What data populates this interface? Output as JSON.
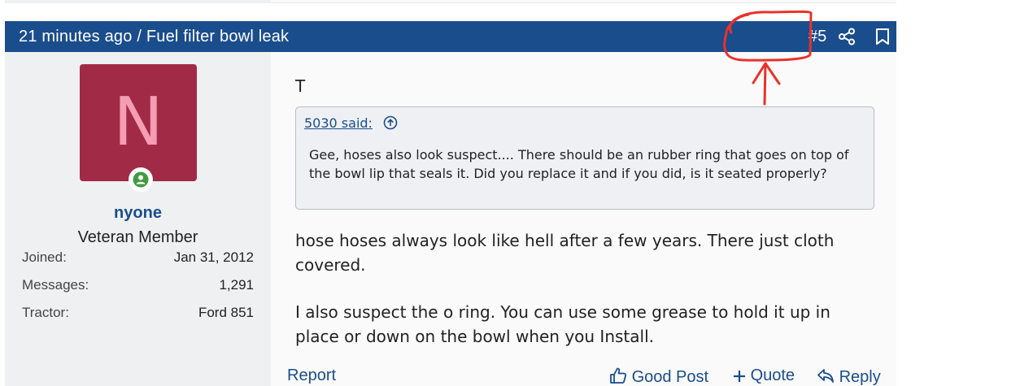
{
  "header": {
    "time_ago": "21 minutes ago",
    "separator": " / ",
    "thread_title": "Fuel filter bowl leak",
    "post_number": "#5",
    "share_icon": "share-icon",
    "bookmark_icon": "bookmark-icon"
  },
  "user": {
    "avatar_letter": "N",
    "avatar_color": "#a12a46",
    "avatar_letter_color": "#f49db3",
    "online_icon": "online-user-icon",
    "name": "nyone",
    "title": "Veteran Member",
    "stats": [
      {
        "label": "Joined:",
        "value": "Jan 31, 2012"
      },
      {
        "label": "Messages:",
        "value": "1,291"
      },
      {
        "label": "Tractor:",
        "value": "Ford 851"
      }
    ]
  },
  "post": {
    "first_line": "T",
    "quote": {
      "attribution": "5030 said:",
      "up_icon": "jump-to-quote-icon",
      "text": "Gee, hoses also look suspect.... There should be an rubber ring that goes on top of the bowl lip that seals it. Did you replace it and if you did, is it seated properly?"
    },
    "paragraphs": [
      "hose hoses always look like hell after a few years. There just cloth covered.",
      "I also suspect the o ring. You can use some grease to hold it up in place or down on the bowl when you Install."
    ]
  },
  "footer": {
    "report": "Report",
    "good_post": "Good Post",
    "quote": "Quote",
    "reply": "Reply"
  },
  "colors": {
    "header_bg": "#1a4d8c",
    "link": "#1a4d8c",
    "annotation": "#e8322a"
  }
}
